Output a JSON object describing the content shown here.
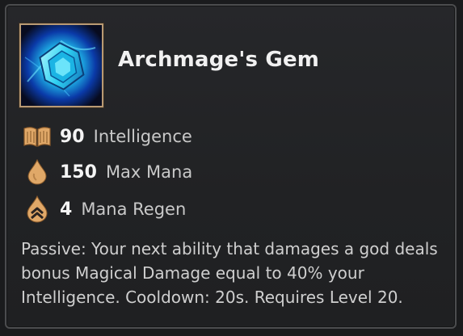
{
  "item": {
    "name": "Archmage's Gem",
    "icon": "archmages-gem-icon"
  },
  "stats": [
    {
      "icon": "book-icon",
      "value": "90",
      "label": "Intelligence"
    },
    {
      "icon": "mana-drop-icon",
      "value": "150",
      "label": "Max Mana"
    },
    {
      "icon": "mana-regen-icon",
      "value": "4",
      "label": "Mana Regen"
    }
  ],
  "passive": "Passive: Your next ability that damages a god deals bonus Magical Damage equal to 40% your Intelligence. Cooldown: 20s. Requires Level 20.",
  "colors": {
    "stat_icon": "#e0a868",
    "frame_border": "#b89a74",
    "background": "#232426"
  }
}
